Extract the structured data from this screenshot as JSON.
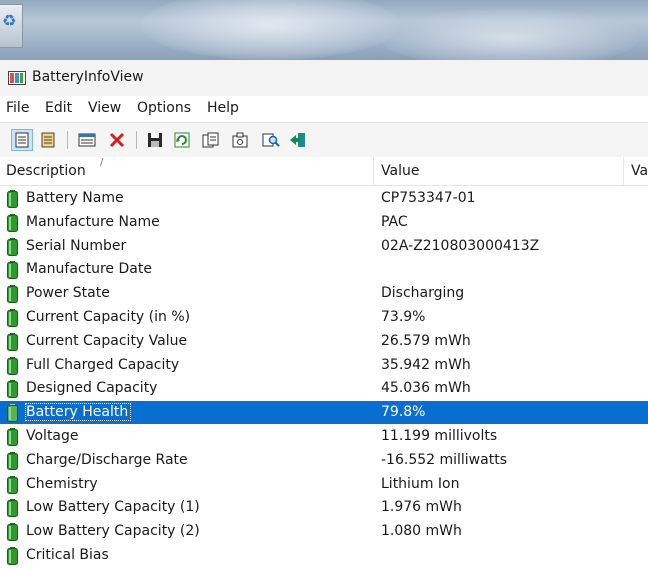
{
  "window": {
    "title": "BatteryInfoView"
  },
  "menu": [
    "File",
    "Edit",
    "View",
    "Options",
    "Help"
  ],
  "toolbar": {
    "icons": [
      "details-view-icon",
      "list-view-icon",
      "html-report-icon",
      "delete-icon",
      "save-icon",
      "refresh-icon",
      "copy-icon",
      "properties-icon",
      "find-icon",
      "exit-icon"
    ]
  },
  "columns": {
    "description": "Description",
    "sort_indicator": "/",
    "value": "Value",
    "value2": "Val"
  },
  "rows": [
    {
      "description": "Battery Name",
      "value": "CP753347-01"
    },
    {
      "description": "Manufacture Name",
      "value": "PAC"
    },
    {
      "description": "Serial Number",
      "value": "02A-Z210803000413Z"
    },
    {
      "description": "Manufacture Date",
      "value": ""
    },
    {
      "description": "Power State",
      "value": "Discharging"
    },
    {
      "description": "Current Capacity (in %)",
      "value": "73.9%"
    },
    {
      "description": "Current Capacity Value",
      "value": "26.579 mWh"
    },
    {
      "description": "Full Charged Capacity",
      "value": "35.942 mWh"
    },
    {
      "description": "Designed Capacity",
      "value": "45.036 mWh"
    },
    {
      "description": "Battery Health",
      "value": "79.8%",
      "selected": true
    },
    {
      "description": "Voltage",
      "value": "11.199 millivolts"
    },
    {
      "description": "Charge/Discharge Rate",
      "value": "-16.552 milliwatts"
    },
    {
      "description": "Chemistry",
      "value": "Lithium Ion"
    },
    {
      "description": "Low Battery Capacity (1)",
      "value": "1.976 mWh"
    },
    {
      "description": "Low Battery Capacity (2)",
      "value": "1.080 mWh"
    },
    {
      "description": "Critical Bias",
      "value": ""
    }
  ],
  "colors": {
    "selection": "#0a6ed1",
    "battery_green": "#2e9a2e"
  }
}
